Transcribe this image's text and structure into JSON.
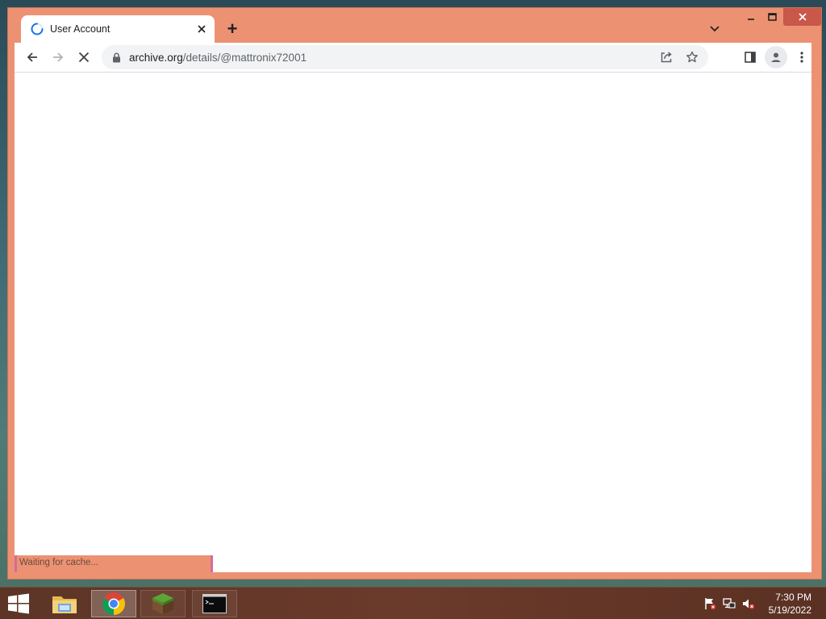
{
  "browser": {
    "tab": {
      "title": "User Account",
      "loading_icon": "spinner-icon",
      "close_icon": "close-icon"
    },
    "new_tab_symbol": "+",
    "tab_search_icon": "chevron-down-icon",
    "window_controls": {
      "minimize": "minimize-icon",
      "maximize": "maximize-icon",
      "close": "close-icon"
    },
    "toolbar": {
      "back_icon": "arrow-left-icon",
      "forward_icon": "arrow-right-icon",
      "stop_icon": "stop-icon",
      "omnibox": {
        "lock_icon": "lock-icon",
        "url_host": "archive.org",
        "url_path": "/details/@mattronix72001",
        "share_icon": "share-icon",
        "bookmark_icon": "star-icon"
      },
      "side_panel_icon": "side-panel-icon",
      "profile_icon": "profile-icon",
      "menu_icon": "kebab-menu-icon"
    },
    "status_text": "Waiting for cache...",
    "colors": {
      "frame": "#ec9272",
      "close_button": "#c9574a",
      "spinner": "#1a73e8"
    }
  },
  "taskbar": {
    "start_icon": "windows-logo-icon",
    "apps": [
      {
        "name": "File Explorer",
        "icon": "folder-icon",
        "state": "pinned"
      },
      {
        "name": "Google Chrome",
        "icon": "chrome-icon",
        "state": "active"
      },
      {
        "name": "Minecraft",
        "icon": "grass-block-icon",
        "state": "open"
      },
      {
        "name": "Command Prompt",
        "icon": "cmd-icon",
        "state": "open"
      }
    ],
    "tray_icons": [
      "action-center-flag-icon",
      "network-icon",
      "volume-muted-icon"
    ],
    "clock": {
      "time": "7:30 PM",
      "date": "5/19/2022"
    }
  }
}
